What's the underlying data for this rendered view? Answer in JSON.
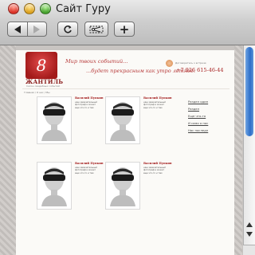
{
  "window": {
    "title": "Сайт Гуру"
  },
  "toolbar": {
    "back": "back",
    "forward": "forward",
    "reload": "reload",
    "screenshot": "screenshot",
    "add": "+"
  },
  "site": {
    "logo_letter": "8",
    "brand": "ЖАНТИЛЬ",
    "brand_sub": "Салон свадебных событий",
    "slogan_line1": "Мир твоих событий...",
    "slogan_line2": "...будет прекрасным как утро летнее.",
    "contact_hint": "Договоритесь о встрече:",
    "phone": "+7 926 615-46-44",
    "breadcrumb": "Главная / О нас / Мы"
  },
  "cards": [
    {
      "name": "Василий Пупкин",
      "desc": "наш замечательный фотограф и может еще что-то и там"
    },
    {
      "name": "Василий Пупкин",
      "desc": "наш замечательный фотограф и может еще что-то и там"
    },
    {
      "name": "Василий Пупкин",
      "desc": "наш замечательный фотограф и может еще что-то и там"
    },
    {
      "name": "Василий Пупкин",
      "desc": "наш замечательный фотограф и может еще что-то и там"
    }
  ],
  "menu": [
    "Раздел один",
    "Раздел",
    "Еще что-то",
    "И само о нас",
    "Нас последн"
  ],
  "colors": {
    "accent": "#a52020",
    "scroll_thumb": "#2c6ec8"
  }
}
